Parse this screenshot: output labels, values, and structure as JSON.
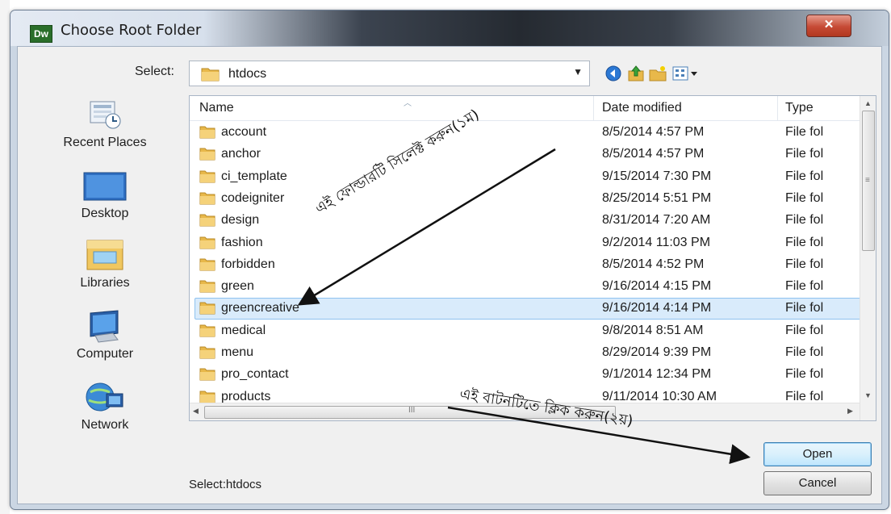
{
  "window": {
    "title": "Choose Root Folder",
    "app_icon_text": "Dw",
    "close_glyph": "✕"
  },
  "toolbar": {
    "select_label": "Select:",
    "current_folder": "htdocs",
    "icons": [
      "back-icon",
      "up-folder-icon",
      "new-folder-icon",
      "views-menu-icon"
    ]
  },
  "places": [
    {
      "label": "Recent Places",
      "icon": "recent-places-icon"
    },
    {
      "label": "Desktop",
      "icon": "desktop-icon"
    },
    {
      "label": "Libraries",
      "icon": "libraries-icon"
    },
    {
      "label": "Computer",
      "icon": "computer-icon"
    },
    {
      "label": "Network",
      "icon": "network-icon"
    }
  ],
  "file_list": {
    "columns": [
      "Name",
      "Date modified",
      "Type"
    ],
    "rows": [
      {
        "name": "account",
        "date": "8/5/2014 4:57 PM",
        "type": "File fol"
      },
      {
        "name": "anchor",
        "date": "8/5/2014 4:57 PM",
        "type": "File fol"
      },
      {
        "name": "ci_template",
        "date": "9/15/2014 7:30 PM",
        "type": "File fol"
      },
      {
        "name": "codeigniter",
        "date": "8/25/2014 5:51 PM",
        "type": "File fol"
      },
      {
        "name": "design",
        "date": "8/31/2014 7:20 AM",
        "type": "File fol"
      },
      {
        "name": "fashion",
        "date": "9/2/2014 11:03 PM",
        "type": "File fol"
      },
      {
        "name": "forbidden",
        "date": "8/5/2014 4:52 PM",
        "type": "File fol"
      },
      {
        "name": "green",
        "date": "9/16/2014 4:15 PM",
        "type": "File fol"
      },
      {
        "name": "greencreative",
        "date": "9/16/2014 4:14 PM",
        "type": "File fol",
        "selected": true
      },
      {
        "name": "medical",
        "date": "9/8/2014 8:51 AM",
        "type": "File fol"
      },
      {
        "name": "menu",
        "date": "8/29/2014 9:39 PM",
        "type": "File fol"
      },
      {
        "name": "pro_contact",
        "date": "9/1/2014 12:34 PM",
        "type": "File fol"
      },
      {
        "name": "products",
        "date": "9/11/2014 10:30 AM",
        "type": "File fol"
      }
    ]
  },
  "buttons": {
    "open": "Open",
    "cancel": "Cancel"
  },
  "status": {
    "text": "Select:htdocs"
  },
  "annotations": {
    "step1": "এই ফোল্ডারটি সিলেক্ট করুন(১ম)",
    "step2": "এই বাটনটিতে ক্লিক করুন(২য়)"
  },
  "colors": {
    "selection_fill": "#d9ebfb",
    "selection_border": "#8fc2ef",
    "close_button": "#c64a35",
    "folder": "#e8b84a"
  }
}
